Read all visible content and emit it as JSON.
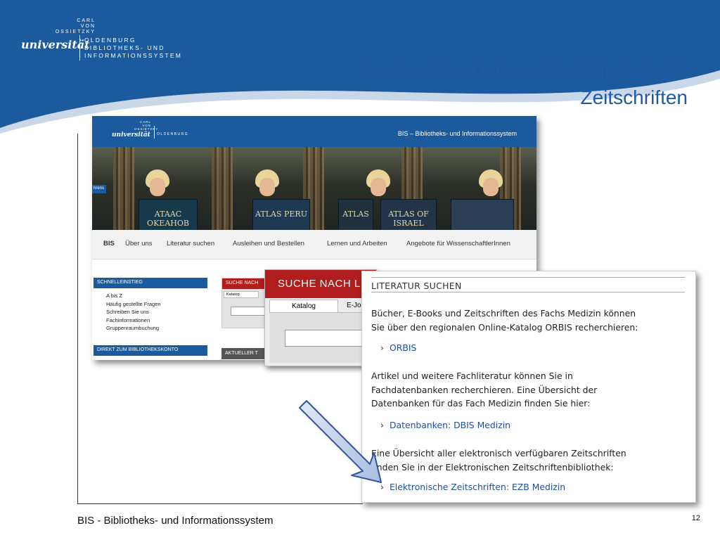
{
  "header": {
    "logo_top": "CARL\nVON\nOSSIETZKY",
    "logo_uni": "universität",
    "logo_right_1": "OLDENBURG",
    "logo_right_2": "BIBLIOTHEKS- UND",
    "logo_right_3": "INFORMATIONSSYSTEM",
    "title_line1": "Bestand der Universitätsbibliothek: E-",
    "title_line2": "Zeitschriften",
    "band_color": "#1b5a9c",
    "title_color": "#1f5aa6"
  },
  "site": {
    "header_bis": "BIS – Bibliotheks- und Informationssystem",
    "logo_top": "CARL VON OSSIETZKY",
    "logo_uni": "universität",
    "logo_old": "OLDENBURG",
    "photo_tab": "hrens",
    "books": [
      "ATAAC OKEAHOB",
      "ATLAS PERU",
      "ATLAS",
      "ATLAS OF ISRAEL",
      ""
    ],
    "nav": [
      "BIS",
      "Über uns",
      "Literatur suchen",
      "Ausleihen und Bestellen",
      "Lernen und Arbeiten",
      "Angebote für WissenschaftlerInnen"
    ],
    "quick_head": "SCHNELLEINSTIEG",
    "quick_items": [
      "A bis Z",
      "Häufig gestellte Fragen",
      "Schreiben Sie uns",
      "Fachinformationen",
      "Gruppenraumbuchung"
    ],
    "account_head": "DIREKT ZUM BIBLIOTHEKSKONTO",
    "search_head": "SUCHE NACH",
    "search_tab": "Katalog",
    "current_head": "AKTUELLER T"
  },
  "search_zoom": {
    "head": "SUCHE NACH LIT",
    "tab_active": "Katalog",
    "tab_other": "E-Jo"
  },
  "lit": {
    "title": "LITERATUR SUCHEN",
    "p1": "Bücher, E-Books und Zeitschriften des Fachs Medizin können\nSie über den regionalen Online-Katalog ORBIS recherchieren:",
    "link1": "ORBIS",
    "p2": "Artikel und weitere Fachliteratur können Sie in\nFachdatenbanken recherchieren. Eine Übersicht der\nDatenbanken für das Fach Medizin finden Sie hier:",
    "link2": "Datenbanken: DBIS Medizin",
    "p3": "Eine Übersicht aller elektronisch verfügbaren Zeitschriften\nfinden Sie in der Elektronischen Zeitschriftenbibliothek:",
    "link3": "Elektronische Zeitschriften: EZB Medizin",
    "chevron": "›"
  },
  "footer": {
    "text": "BIS - Bibliotheks- und Informationssystem",
    "page": "12"
  }
}
